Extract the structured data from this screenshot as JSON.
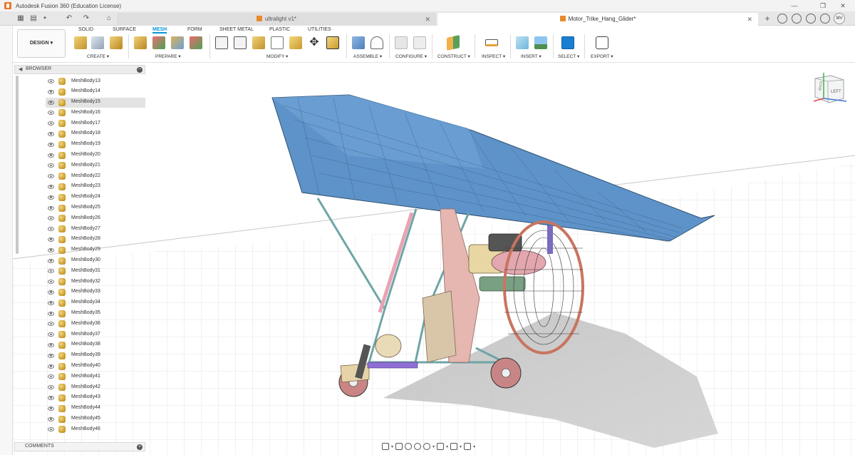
{
  "window": {
    "title": "Autodesk Fusion 360 (Education License)",
    "controls": [
      "—",
      "❐",
      "✕"
    ]
  },
  "tabs": [
    {
      "label": "ultralight v1*",
      "active": false
    },
    {
      "label": "Motor_Trike_Hang_Glider*",
      "active": true
    }
  ],
  "user": {
    "initials": "MV"
  },
  "toolbar": {
    "design_label": "DESIGN ▾",
    "workspace_tabs": [
      "SOLID",
      "SURFACE",
      "MESH",
      "FORM",
      "SHEET METAL",
      "PLASTIC",
      "UTILITIES"
    ],
    "active_workspace": "MESH",
    "groups": [
      {
        "label": "CREATE ▾"
      },
      {
        "label": "PREPARE ▾"
      },
      {
        "label": "MODIFY ▾"
      },
      {
        "label": "ASSEMBLE ▾"
      },
      {
        "label": "CONFIGURE ▾"
      },
      {
        "label": "CONSTRUCT ▾"
      },
      {
        "label": "INSPECT ▾"
      },
      {
        "label": "INSERT ▾"
      },
      {
        "label": "SELECT ▾"
      },
      {
        "label": "EXPORT ▾"
      }
    ]
  },
  "browser": {
    "title": "BROWSER",
    "selected_item": "MeshBody15",
    "items": [
      "MeshBody13",
      "MeshBody14",
      "MeshBody15",
      "MeshBody16",
      "MeshBody17",
      "MeshBody18",
      "MeshBody19",
      "MeshBody20",
      "MeshBody21",
      "MeshBody22",
      "MeshBody23",
      "MeshBody24",
      "MeshBody25",
      "MeshBody26",
      "MeshBody27",
      "MeshBody28",
      "MeshBody29",
      "MeshBody30",
      "MeshBody31",
      "MeshBody32",
      "MeshBody33",
      "MeshBody34",
      "MeshBody35",
      "MeshBody36",
      "MeshBody37",
      "MeshBody38",
      "MeshBody39",
      "MeshBody40",
      "MeshBody41",
      "MeshBody42",
      "MeshBody43",
      "MeshBody44",
      "MeshBody45",
      "MeshBody46"
    ]
  },
  "comments": {
    "title": "COMMENTS"
  },
  "viewcube": {
    "face_label": "LEFT",
    "side_label": "BACK"
  },
  "colors": {
    "accent": "#0696d7",
    "wing": "#5e93c9",
    "frame": "#6fa5a7",
    "engine": "#e6b6b0",
    "tire": "#c98585",
    "prop": "#c8755f",
    "grid": "#d9d9d9"
  }
}
